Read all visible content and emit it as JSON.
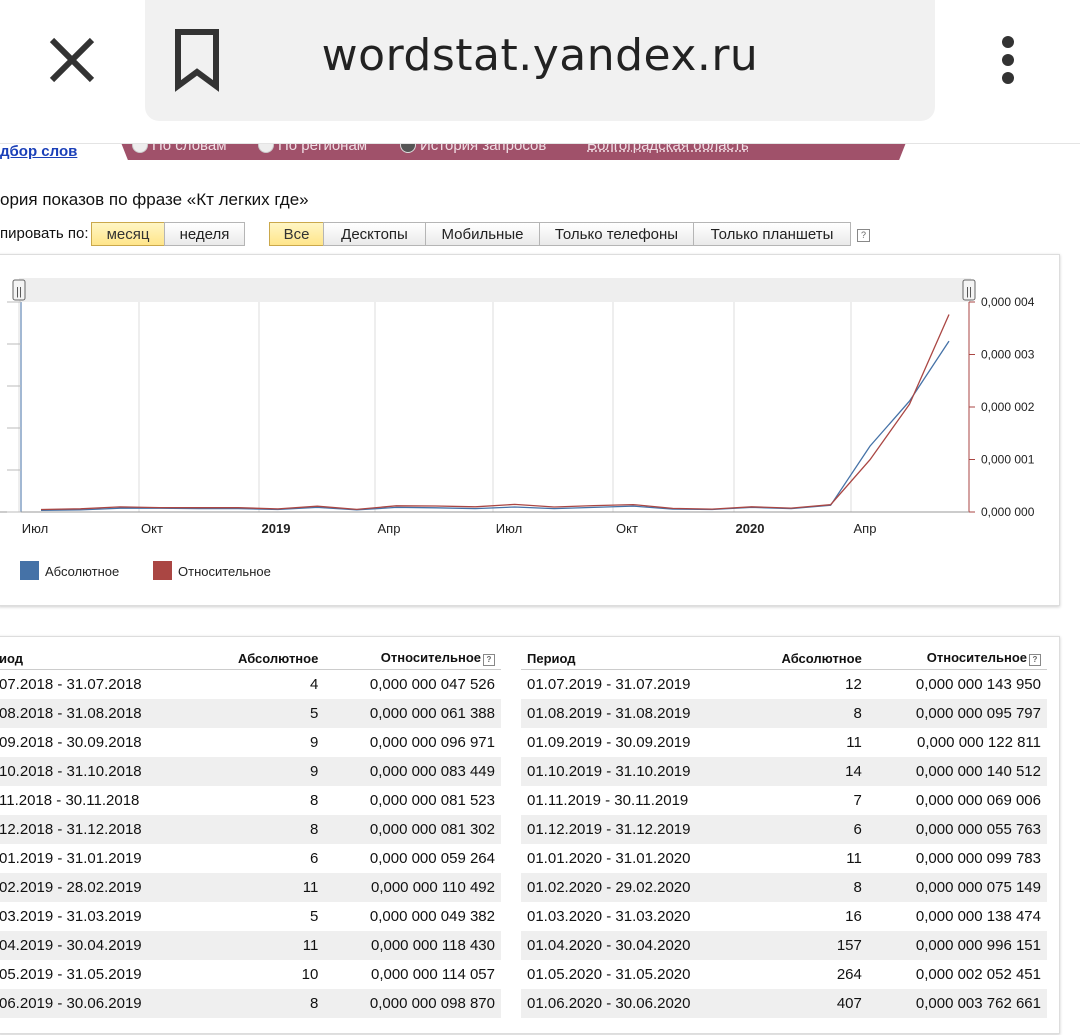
{
  "browser": {
    "url": "wordstat.yandex.ru"
  },
  "nav": {
    "podbor_link": "дбор слов",
    "modes": [
      "По словам",
      "По регионам",
      "История запросов"
    ],
    "region": "Волгоградская область"
  },
  "phrase_title": "ория показов по фразе «Кт легких где»",
  "grouping": {
    "label": "пировать по:",
    "options": [
      "месяц",
      "неделя"
    ],
    "selected": "месяц"
  },
  "devices": {
    "options": [
      "Все",
      "Десктопы",
      "Мобильные",
      "Только телефоны",
      "Только планшеты"
    ],
    "selected": "Все",
    "help": "?"
  },
  "colors": {
    "absolute": "#4572a7",
    "relative": "#aa4643",
    "active_button": "#ffe58a",
    "mode_bar": "#a0516a"
  },
  "chart_data": {
    "type": "line",
    "x": [
      "07.2018",
      "08.2018",
      "09.2018",
      "10.2018",
      "11.2018",
      "12.2018",
      "01.2019",
      "02.2019",
      "03.2019",
      "04.2019",
      "05.2019",
      "06.2019",
      "07.2019",
      "08.2019",
      "09.2019",
      "10.2019",
      "11.2019",
      "12.2019",
      "01.2020",
      "02.2020",
      "03.2020",
      "04.2020",
      "05.2020",
      "06.2020"
    ],
    "x_tick_labels": [
      "Июл",
      "Окт",
      "2019",
      "Апр",
      "Июл",
      "Окт",
      "2020",
      "Апр"
    ],
    "series": [
      {
        "name": "Абсолютное",
        "values": [
          4,
          5,
          9,
          9,
          8,
          8,
          6,
          11,
          5,
          11,
          10,
          8,
          12,
          8,
          11,
          14,
          7,
          6,
          11,
          8,
          16,
          157,
          264,
          407
        ]
      },
      {
        "name": "Относительное",
        "values": [
          4.7526e-08,
          6.1388e-08,
          9.6971e-08,
          8.3449e-08,
          8.1523e-08,
          8.1302e-08,
          5.9264e-08,
          1.10492e-07,
          4.9382e-08,
          1.1843e-07,
          1.14057e-07,
          9.887e-08,
          1.4395e-07,
          9.5797e-08,
          1.22811e-07,
          1.40512e-07,
          6.9006e-08,
          5.5763e-08,
          9.9783e-08,
          7.5149e-08,
          1.38474e-07,
          9.96151e-07,
          2.052451e-06,
          3.762661e-06
        ]
      }
    ],
    "y_left_range": [
      0,
      500
    ],
    "y_right_ticks": [
      "0,000 004",
      "0,000 003",
      "0,000 002",
      "0,000 001",
      "0,000 000"
    ],
    "y_right_range": [
      0,
      4e-06
    ],
    "grid": "vertical",
    "legend": "bottom-left",
    "handle_glyph": "||"
  },
  "table": {
    "headers": {
      "period": "иод",
      "period2": "Период",
      "absolute": "Абсолютное",
      "relative": "Относительное"
    },
    "left": [
      {
        "period": "07.2018 - 31.07.2018",
        "abs": "4",
        "rel": "0,000 000 047 526"
      },
      {
        "period": "08.2018 - 31.08.2018",
        "abs": "5",
        "rel": "0,000 000 061 388"
      },
      {
        "period": "09.2018 - 30.09.2018",
        "abs": "9",
        "rel": "0,000 000 096 971"
      },
      {
        "period": "10.2018 - 31.10.2018",
        "abs": "9",
        "rel": "0,000 000 083 449"
      },
      {
        "period": "11.2018 - 30.11.2018",
        "abs": "8",
        "rel": "0,000 000 081 523"
      },
      {
        "period": "12.2018 - 31.12.2018",
        "abs": "8",
        "rel": "0,000 000 081 302"
      },
      {
        "period": "01.2019 - 31.01.2019",
        "abs": "6",
        "rel": "0,000 000 059 264"
      },
      {
        "period": "02.2019 - 28.02.2019",
        "abs": "11",
        "rel": "0,000 000 110 492"
      },
      {
        "period": "03.2019 - 31.03.2019",
        "abs": "5",
        "rel": "0,000 000 049 382"
      },
      {
        "period": "04.2019 - 30.04.2019",
        "abs": "11",
        "rel": "0,000 000 118 430"
      },
      {
        "period": "05.2019 - 31.05.2019",
        "abs": "10",
        "rel": "0,000 000 114 057"
      },
      {
        "period": "06.2019 - 30.06.2019",
        "abs": "8",
        "rel": "0,000 000 098 870"
      }
    ],
    "right": [
      {
        "period": "01.07.2019 - 31.07.2019",
        "abs": "12",
        "rel": "0,000 000 143 950"
      },
      {
        "period": "01.08.2019 - 31.08.2019",
        "abs": "8",
        "rel": "0,000 000 095 797"
      },
      {
        "period": "01.09.2019 - 30.09.2019",
        "abs": "11",
        "rel": "0,000 000 122 811"
      },
      {
        "period": "01.10.2019 - 31.10.2019",
        "abs": "14",
        "rel": "0,000 000 140 512"
      },
      {
        "period": "01.11.2019 - 30.11.2019",
        "abs": "7",
        "rel": "0,000 000 069 006"
      },
      {
        "period": "01.12.2019 - 31.12.2019",
        "abs": "6",
        "rel": "0,000 000 055 763"
      },
      {
        "period": "01.01.2020 - 31.01.2020",
        "abs": "11",
        "rel": "0,000 000 099 783"
      },
      {
        "period": "01.02.2020 - 29.02.2020",
        "abs": "8",
        "rel": "0,000 000 075 149"
      },
      {
        "period": "01.03.2020 - 31.03.2020",
        "abs": "16",
        "rel": "0,000 000 138 474"
      },
      {
        "period": "01.04.2020 - 30.04.2020",
        "abs": "157",
        "rel": "0,000 000 996 151"
      },
      {
        "period": "01.05.2020 - 31.05.2020",
        "abs": "264",
        "rel": "0,000 002 052 451"
      },
      {
        "period": "01.06.2020 - 30.06.2020",
        "abs": "407",
        "rel": "0,000 003 762 661"
      }
    ]
  }
}
